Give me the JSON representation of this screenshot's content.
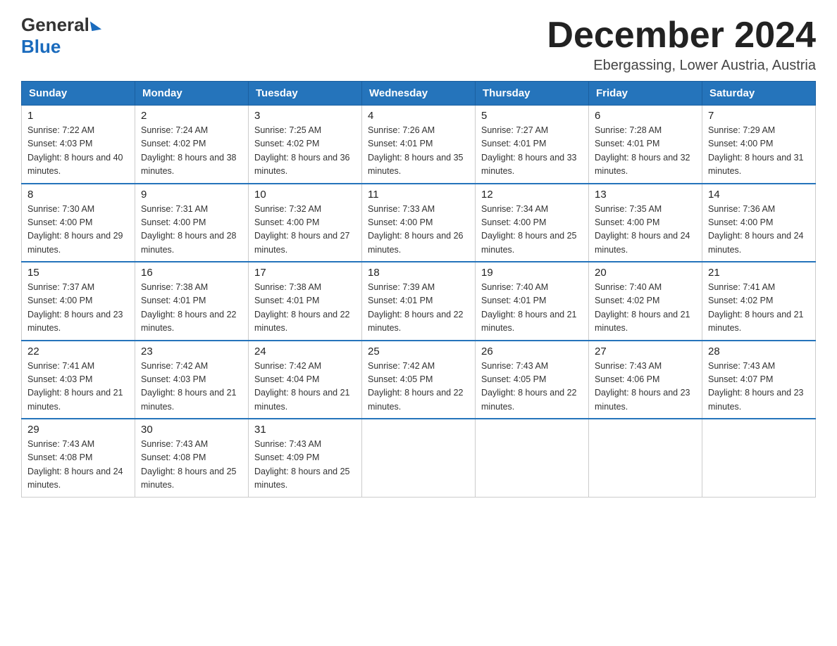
{
  "logo": {
    "general": "General",
    "blue": "Blue"
  },
  "title": "December 2024",
  "location": "Ebergassing, Lower Austria, Austria",
  "days_of_week": [
    "Sunday",
    "Monday",
    "Tuesday",
    "Wednesday",
    "Thursday",
    "Friday",
    "Saturday"
  ],
  "weeks": [
    [
      {
        "num": "1",
        "sunrise": "Sunrise: 7:22 AM",
        "sunset": "Sunset: 4:03 PM",
        "daylight": "Daylight: 8 hours and 40 minutes."
      },
      {
        "num": "2",
        "sunrise": "Sunrise: 7:24 AM",
        "sunset": "Sunset: 4:02 PM",
        "daylight": "Daylight: 8 hours and 38 minutes."
      },
      {
        "num": "3",
        "sunrise": "Sunrise: 7:25 AM",
        "sunset": "Sunset: 4:02 PM",
        "daylight": "Daylight: 8 hours and 36 minutes."
      },
      {
        "num": "4",
        "sunrise": "Sunrise: 7:26 AM",
        "sunset": "Sunset: 4:01 PM",
        "daylight": "Daylight: 8 hours and 35 minutes."
      },
      {
        "num": "5",
        "sunrise": "Sunrise: 7:27 AM",
        "sunset": "Sunset: 4:01 PM",
        "daylight": "Daylight: 8 hours and 33 minutes."
      },
      {
        "num": "6",
        "sunrise": "Sunrise: 7:28 AM",
        "sunset": "Sunset: 4:01 PM",
        "daylight": "Daylight: 8 hours and 32 minutes."
      },
      {
        "num": "7",
        "sunrise": "Sunrise: 7:29 AM",
        "sunset": "Sunset: 4:00 PM",
        "daylight": "Daylight: 8 hours and 31 minutes."
      }
    ],
    [
      {
        "num": "8",
        "sunrise": "Sunrise: 7:30 AM",
        "sunset": "Sunset: 4:00 PM",
        "daylight": "Daylight: 8 hours and 29 minutes."
      },
      {
        "num": "9",
        "sunrise": "Sunrise: 7:31 AM",
        "sunset": "Sunset: 4:00 PM",
        "daylight": "Daylight: 8 hours and 28 minutes."
      },
      {
        "num": "10",
        "sunrise": "Sunrise: 7:32 AM",
        "sunset": "Sunset: 4:00 PM",
        "daylight": "Daylight: 8 hours and 27 minutes."
      },
      {
        "num": "11",
        "sunrise": "Sunrise: 7:33 AM",
        "sunset": "Sunset: 4:00 PM",
        "daylight": "Daylight: 8 hours and 26 minutes."
      },
      {
        "num": "12",
        "sunrise": "Sunrise: 7:34 AM",
        "sunset": "Sunset: 4:00 PM",
        "daylight": "Daylight: 8 hours and 25 minutes."
      },
      {
        "num": "13",
        "sunrise": "Sunrise: 7:35 AM",
        "sunset": "Sunset: 4:00 PM",
        "daylight": "Daylight: 8 hours and 24 minutes."
      },
      {
        "num": "14",
        "sunrise": "Sunrise: 7:36 AM",
        "sunset": "Sunset: 4:00 PM",
        "daylight": "Daylight: 8 hours and 24 minutes."
      }
    ],
    [
      {
        "num": "15",
        "sunrise": "Sunrise: 7:37 AM",
        "sunset": "Sunset: 4:00 PM",
        "daylight": "Daylight: 8 hours and 23 minutes."
      },
      {
        "num": "16",
        "sunrise": "Sunrise: 7:38 AM",
        "sunset": "Sunset: 4:01 PM",
        "daylight": "Daylight: 8 hours and 22 minutes."
      },
      {
        "num": "17",
        "sunrise": "Sunrise: 7:38 AM",
        "sunset": "Sunset: 4:01 PM",
        "daylight": "Daylight: 8 hours and 22 minutes."
      },
      {
        "num": "18",
        "sunrise": "Sunrise: 7:39 AM",
        "sunset": "Sunset: 4:01 PM",
        "daylight": "Daylight: 8 hours and 22 minutes."
      },
      {
        "num": "19",
        "sunrise": "Sunrise: 7:40 AM",
        "sunset": "Sunset: 4:01 PM",
        "daylight": "Daylight: 8 hours and 21 minutes."
      },
      {
        "num": "20",
        "sunrise": "Sunrise: 7:40 AM",
        "sunset": "Sunset: 4:02 PM",
        "daylight": "Daylight: 8 hours and 21 minutes."
      },
      {
        "num": "21",
        "sunrise": "Sunrise: 7:41 AM",
        "sunset": "Sunset: 4:02 PM",
        "daylight": "Daylight: 8 hours and 21 minutes."
      }
    ],
    [
      {
        "num": "22",
        "sunrise": "Sunrise: 7:41 AM",
        "sunset": "Sunset: 4:03 PM",
        "daylight": "Daylight: 8 hours and 21 minutes."
      },
      {
        "num": "23",
        "sunrise": "Sunrise: 7:42 AM",
        "sunset": "Sunset: 4:03 PM",
        "daylight": "Daylight: 8 hours and 21 minutes."
      },
      {
        "num": "24",
        "sunrise": "Sunrise: 7:42 AM",
        "sunset": "Sunset: 4:04 PM",
        "daylight": "Daylight: 8 hours and 21 minutes."
      },
      {
        "num": "25",
        "sunrise": "Sunrise: 7:42 AM",
        "sunset": "Sunset: 4:05 PM",
        "daylight": "Daylight: 8 hours and 22 minutes."
      },
      {
        "num": "26",
        "sunrise": "Sunrise: 7:43 AM",
        "sunset": "Sunset: 4:05 PM",
        "daylight": "Daylight: 8 hours and 22 minutes."
      },
      {
        "num": "27",
        "sunrise": "Sunrise: 7:43 AM",
        "sunset": "Sunset: 4:06 PM",
        "daylight": "Daylight: 8 hours and 23 minutes."
      },
      {
        "num": "28",
        "sunrise": "Sunrise: 7:43 AM",
        "sunset": "Sunset: 4:07 PM",
        "daylight": "Daylight: 8 hours and 23 minutes."
      }
    ],
    [
      {
        "num": "29",
        "sunrise": "Sunrise: 7:43 AM",
        "sunset": "Sunset: 4:08 PM",
        "daylight": "Daylight: 8 hours and 24 minutes."
      },
      {
        "num": "30",
        "sunrise": "Sunrise: 7:43 AM",
        "sunset": "Sunset: 4:08 PM",
        "daylight": "Daylight: 8 hours and 25 minutes."
      },
      {
        "num": "31",
        "sunrise": "Sunrise: 7:43 AM",
        "sunset": "Sunset: 4:09 PM",
        "daylight": "Daylight: 8 hours and 25 minutes."
      },
      null,
      null,
      null,
      null
    ]
  ]
}
